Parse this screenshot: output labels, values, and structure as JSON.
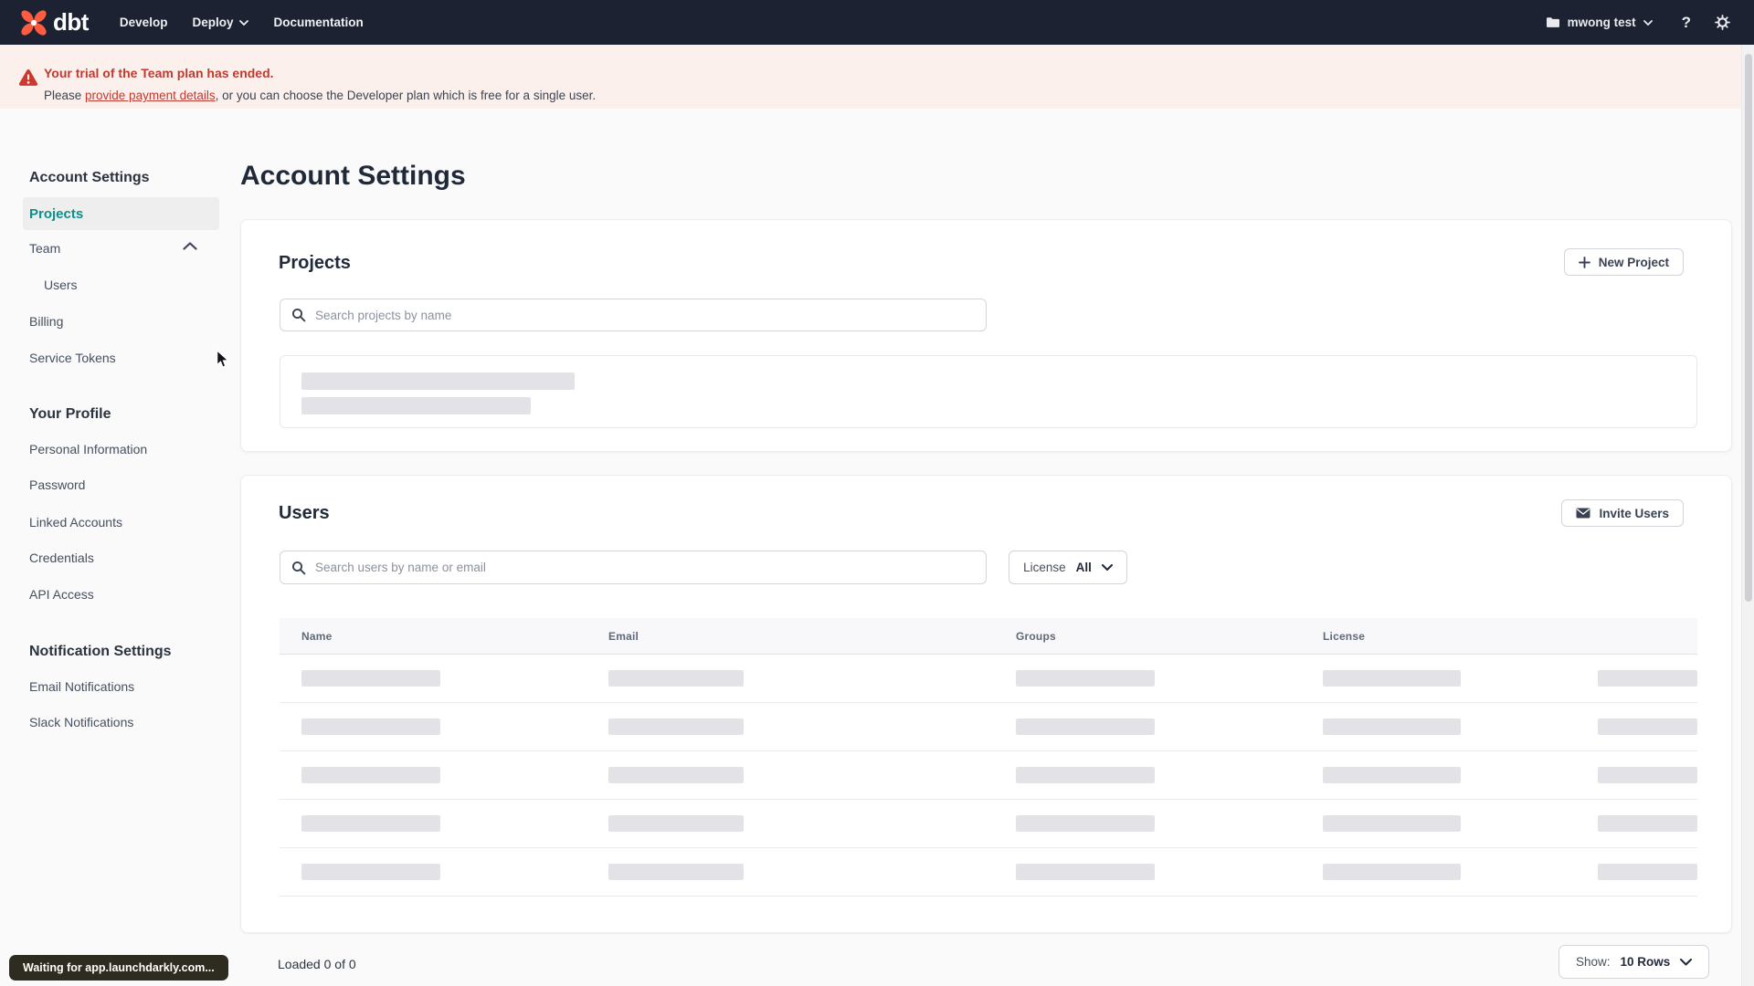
{
  "nav": {
    "logo_text": "dbt",
    "develop": "Develop",
    "deploy": "Deploy",
    "documentation": "Documentation",
    "account_name": "mwong test"
  },
  "banner": {
    "title": "Your trial of the Team plan has ended.",
    "body_prefix": "Please ",
    "link_text": "provide payment details",
    "body_suffix": ", or you can choose the Developer plan which is free for a single user."
  },
  "sidebar": {
    "sections": [
      {
        "header": "Account Settings",
        "items": [
          {
            "label": "Projects",
            "state": "active"
          },
          {
            "label": "Team",
            "state": "expanded"
          },
          {
            "label": "Users",
            "state": "sub-item"
          },
          {
            "label": "Billing",
            "state": "default"
          },
          {
            "label": "Service Tokens",
            "state": "default"
          }
        ]
      },
      {
        "header": "Your Profile",
        "items": [
          {
            "label": "Personal Information",
            "state": "default"
          },
          {
            "label": "Password",
            "state": "default"
          },
          {
            "label": "Linked Accounts",
            "state": "default"
          },
          {
            "label": "Credentials",
            "state": "default"
          },
          {
            "label": "API Access",
            "state": "default"
          }
        ]
      },
      {
        "header": "Notification Settings",
        "items": [
          {
            "label": "Email Notifications",
            "state": "default"
          },
          {
            "label": "Slack Notifications",
            "state": "default"
          }
        ]
      }
    ]
  },
  "main": {
    "page_title": "Account Settings",
    "projects": {
      "title": "Projects",
      "new_project_button": "New Project",
      "search_placeholder": "Search projects by name",
      "loading_skeleton_rows": 2
    },
    "users": {
      "title": "Users",
      "invite_button": "Invite Users",
      "search_placeholder": "Search users by name or email",
      "license_label": "License",
      "license_value": "All",
      "table_headers": [
        "Name",
        "Email",
        "Groups",
        "License"
      ],
      "loading_skeleton_rows": 5
    },
    "footer": {
      "loaded_text": "Loaded 0 of 0",
      "show_label": "Show:",
      "show_value": "10 Rows"
    }
  },
  "status_bar": {
    "text": "Waiting for app.launchdarkly.com..."
  },
  "colors": {
    "brand_orange": "#ff5c42",
    "accent_teal": "#0e8e8a",
    "alert_red": "#bf3a30",
    "banner_bg": "#fcf0ed",
    "nav_bg": "#1c2231",
    "skeleton_gray": "#e3e3e7"
  }
}
